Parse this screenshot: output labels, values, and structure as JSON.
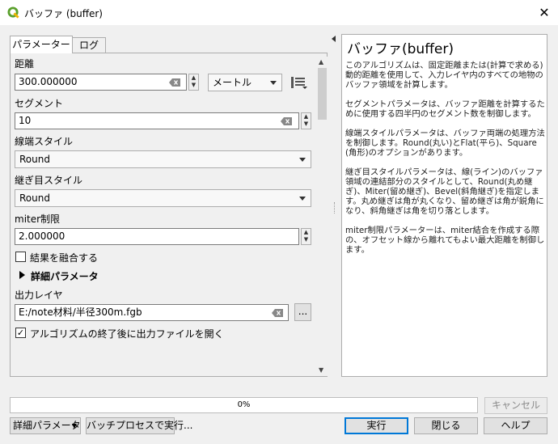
{
  "window": {
    "title": "バッファ (buffer)"
  },
  "tabs": [
    "パラメーター",
    "ログ"
  ],
  "params": {
    "distance_label": "距離",
    "distance_value": "300.000000",
    "unit": "メートル",
    "segments_label": "セグメント",
    "segments_value": "10",
    "endcap_label": "線端スタイル",
    "endcap_value": "Round",
    "join_label": "継ぎ目スタイル",
    "join_value": "Round",
    "miter_label": "miter制限",
    "miter_value": "2.000000",
    "dissolve_label": "結果を融合する",
    "dissolve_checked": false,
    "advanced_label": "詳細パラメータ",
    "output_label": "出力レイヤ",
    "output_value": "E:/note材料/半径300m.fgb",
    "browse_label": "...",
    "open_output_label": "アルゴリズムの終了後に出力ファイルを開く",
    "open_output_checked": true
  },
  "help": {
    "title": "バッファ(buffer)",
    "paragraphs": [
      "このアルゴリズムは、固定距離または(計算で求める)動的距離を使用して、入力レイヤ内のすべての地物のバッファ領域を計算します。",
      "セグメントパラメータは、バッファ距離を計算するために使用する四半円のセグメント数を制御します。",
      "線端スタイルパラメータは、バッファ両端の処理方法を制御します。Round(丸い)とFlat(平ら)、Square(角形)のオプションがあります。",
      "継ぎ目スタイルパラメータは、線(ライン)のバッファ領域の連結部分のスタイルとして、Round(丸め継ぎ)、Miter(留め継ぎ)、Bevel(斜角継ぎ)を指定します。丸め継ぎは角が丸くなり、留め継ぎは角が鋭角になり、斜角継ぎは角を切り落とします。",
      "miter制限パラメーターは、miter結合を作成する際の、オフセット線から離れてもよい最大距離を制御します。"
    ]
  },
  "progress": {
    "value": 0,
    "label": "0%"
  },
  "buttons": {
    "cancel": "キャンセル",
    "advanced": "詳細パラメータ",
    "batch": "バッチプロセスで実行...",
    "run": "実行",
    "close": "閉じる",
    "help": "ヘルプ"
  },
  "colors": {
    "qgis_green": "#5aa02c",
    "focus_blue": "#0078d7"
  }
}
